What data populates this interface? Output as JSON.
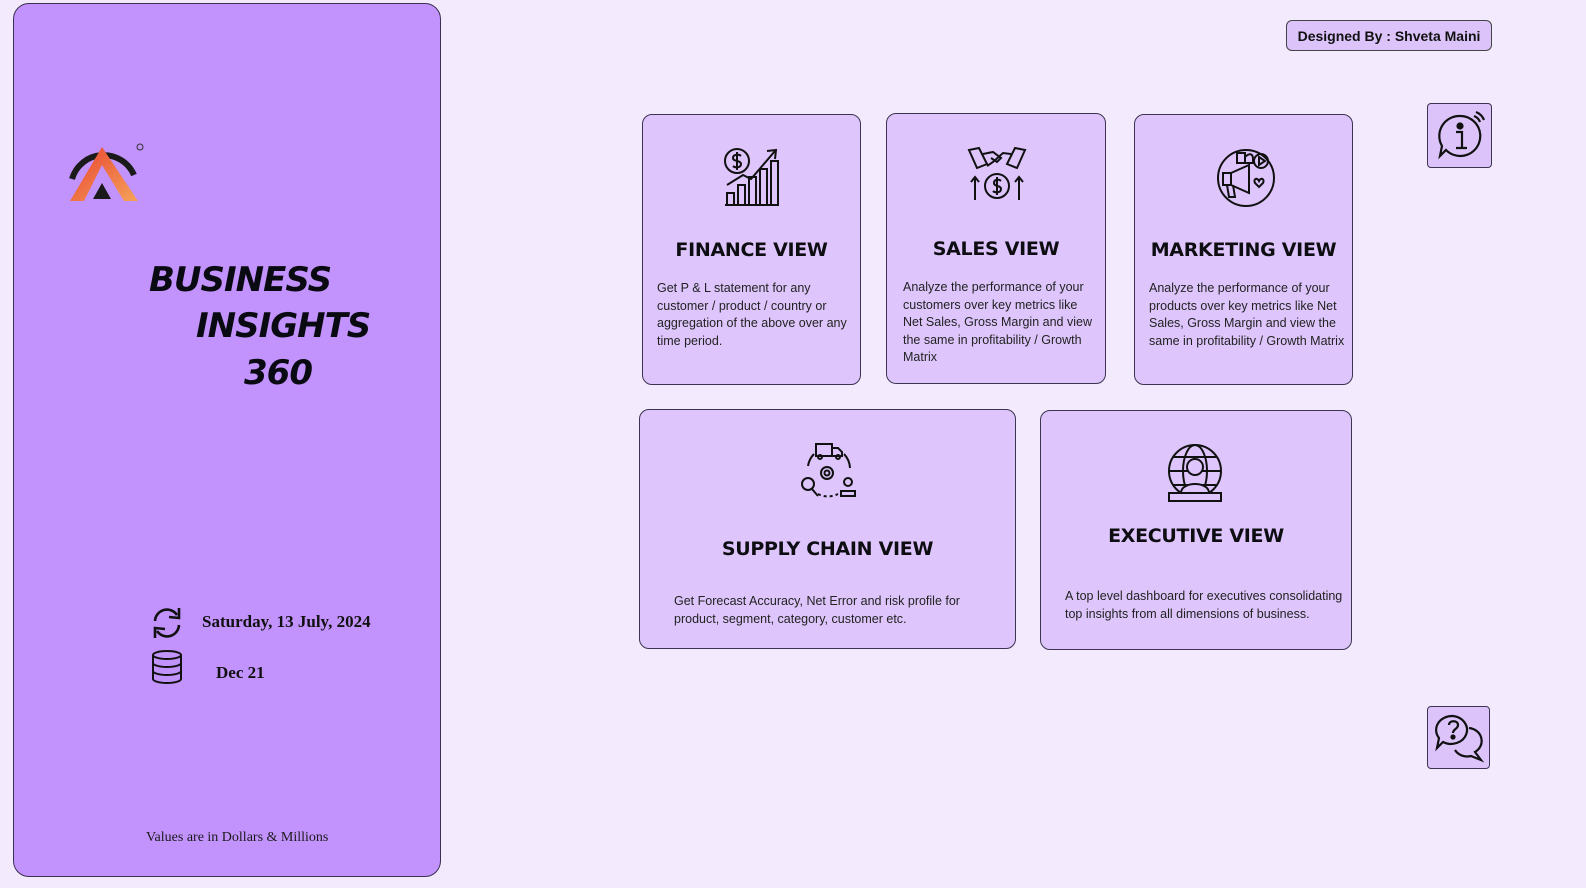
{
  "panel": {
    "title_lines": [
      "BUSINESS",
      "INSIGHTS",
      "360"
    ],
    "refresh_date": "Saturday, 13 July, 2024",
    "data_period": "Dec 21",
    "footnote": "Values are in Dollars & Millions"
  },
  "designed_by": "Designed By : Shveta Maini",
  "cards": {
    "finance": {
      "title": "FINANCE VIEW",
      "description": "Get  P & L statement for any customer / product / country or aggregation of the above over any time period.",
      "icon": "finance-growth-icon"
    },
    "sales": {
      "title": "SALES VIEW",
      "description": "Analyze the performance of your customers over key metrics like Net Sales, Gross Margin and view the same in profitability / Growth Matrix",
      "icon": "handshake-money-icon"
    },
    "marketing": {
      "title": "MARKETING VIEW",
      "description": "Analyze the performance of your products over key metrics like Net Sales, Gross Margin and view the same in profitability / Growth Matrix",
      "icon": "marketing-megaphone-icon"
    },
    "supply_chain": {
      "title": "SUPPLY CHAIN VIEW",
      "description": "Get Forecast Accuracy, Net Error and risk profile for product, segment, category, customer etc.",
      "icon": "supply-chain-cycle-icon"
    },
    "executive": {
      "title": "EXECUTIVE VIEW",
      "description": "A top level dashboard for executives consolidating top insights from all dimensions of business.",
      "icon": "executive-globe-icon"
    }
  },
  "buttons": {
    "info_icon": "info-icon",
    "help_icon": "help-chat-icon"
  },
  "colors": {
    "page_background": "#f4eafd",
    "panel_background": "#c292fd",
    "card_background": "#dec6fc",
    "logo_gradient_start": "#e8412f",
    "logo_gradient_end": "#f5a25a"
  }
}
